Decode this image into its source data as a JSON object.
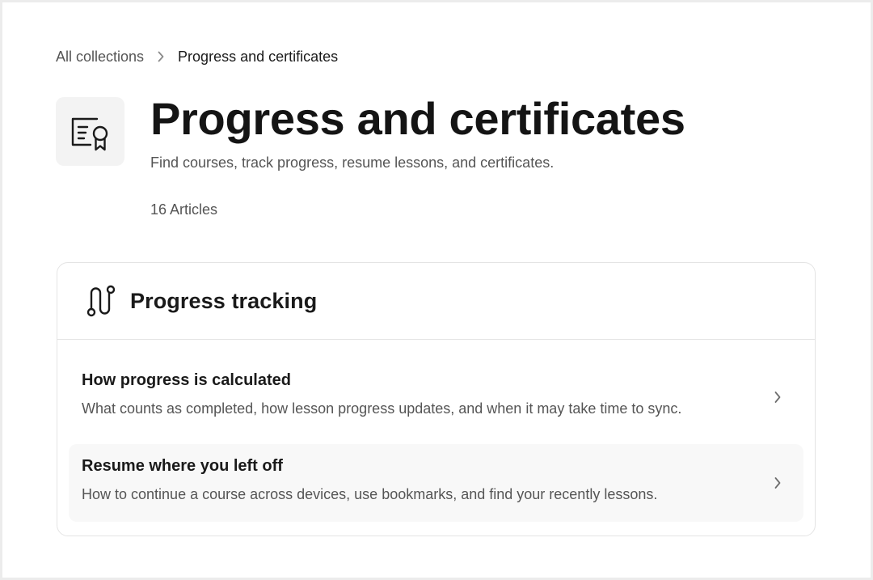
{
  "breadcrumb": {
    "parent": "All collections",
    "separator_icon": "chevron-right-icon",
    "current": "Progress and certificates"
  },
  "collection": {
    "icon": "certificate-icon",
    "title": "Progress and certificates",
    "description": "Find courses, track progress, resume lessons, and certificates.",
    "article_count": "16 Articles"
  },
  "section": {
    "icon": "route-icon",
    "title": "Progress tracking",
    "articles": [
      {
        "title": "How progress is calculated",
        "description": "What counts as completed, how lesson progress updates, and when it may take time to sync.",
        "icon": "chevron-right-icon"
      },
      {
        "title": "Resume where you left off",
        "description": "How to continue a course across devices, use bookmarks, and find your recently lessons.",
        "icon": "chevron-right-icon"
      }
    ]
  },
  "colors": {
    "background": "#ececec",
    "surface": "#ffffff",
    "text_primary": "#1a1a1a",
    "text_secondary": "#555555",
    "border": "#e4e4e4",
    "row_highlight": "#f8f8f8"
  }
}
